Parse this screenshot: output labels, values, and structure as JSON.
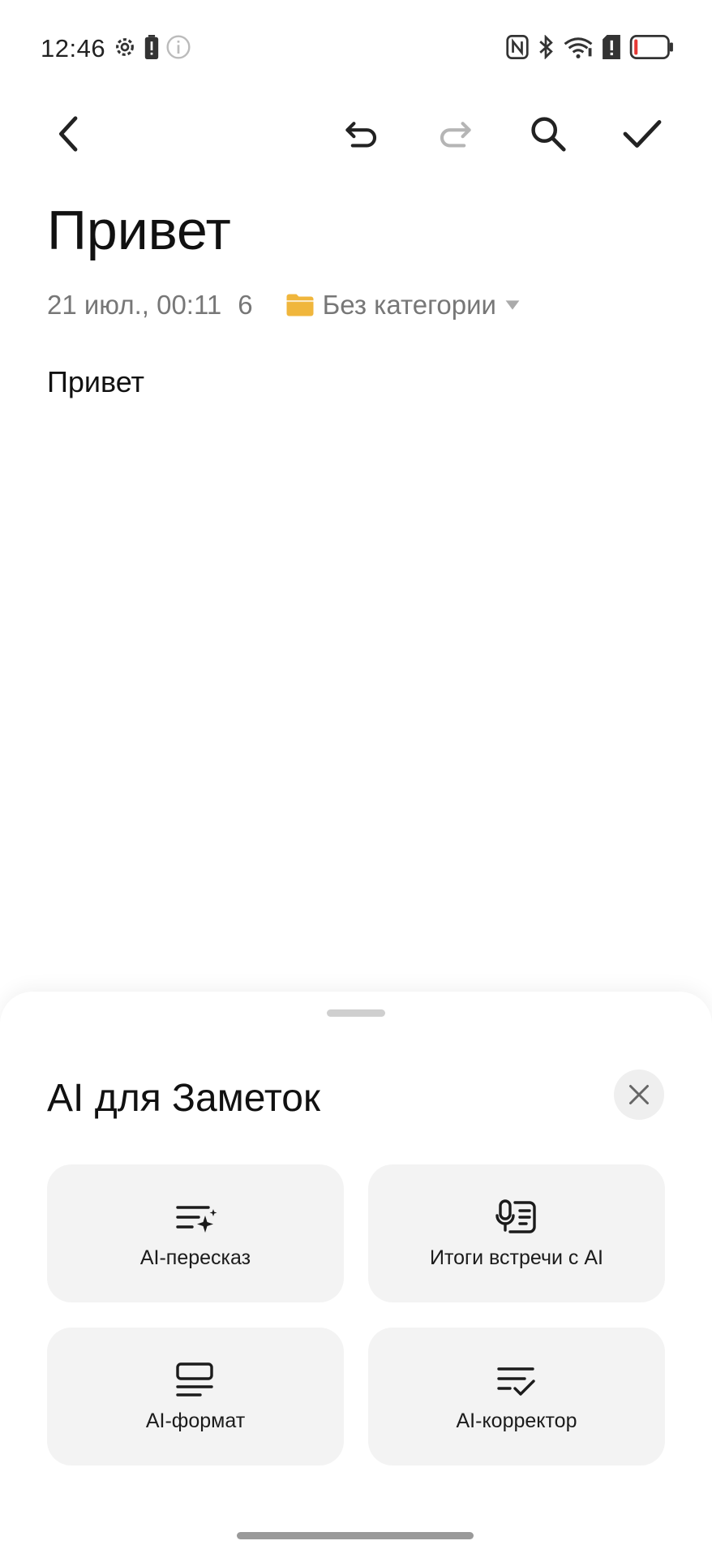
{
  "status_bar": {
    "time": "12:46",
    "left_icons": [
      "gear-icon",
      "battery-alert-icon",
      "info-icon"
    ],
    "right_icons": [
      "nfc-icon",
      "bluetooth-icon",
      "wifi-icon",
      "sim-alert-icon",
      "battery-low-icon"
    ],
    "battery_low_color": "#e53935"
  },
  "toolbar": {
    "buttons": [
      "back",
      "undo",
      "redo",
      "search",
      "done"
    ],
    "redo_disabled": true
  },
  "note": {
    "title": "Привет",
    "date": "21 июл., 00:11",
    "char_count": "6",
    "category": "Без категории",
    "category_icon_color": "#f0b63c",
    "body": "Привет"
  },
  "ai_sheet": {
    "title": "AI для Заметок",
    "actions": [
      {
        "label": "AI-пересказ",
        "icon": "summary-sparkle-icon"
      },
      {
        "label": "Итоги встречи с AI",
        "icon": "meeting-mic-icon"
      },
      {
        "label": "AI-формат",
        "icon": "format-icon"
      },
      {
        "label": "AI-корректор",
        "icon": "proofread-icon"
      }
    ]
  }
}
